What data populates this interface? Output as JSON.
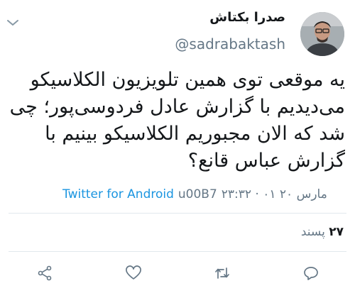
{
  "tweet": {
    "display_name": "صدرا بکتاش",
    "handle": "@sadrabaktash",
    "text": "یه موقعی توی همین تلویزیون الکلاسیکو می‌دیدیم با گزارش عادل فردوسی‌پور؛ چی شد که الان مجبوریم الکلاسیکو بینیم با گزارش عباس قانع؟",
    "timestamp": "۲۳:۳۲ · ۰۱ مارس ۲۰",
    "separator": "u00B7",
    "source": "Twitter for Android",
    "likes_count": "۲۷",
    "likes_label": "پسند"
  },
  "icons": {
    "menu": "chevron-down-icon",
    "share": "share-icon",
    "like": "heart-icon",
    "retweet": "retweet-icon",
    "reply": "reply-icon"
  },
  "colors": {
    "link": "#1b95e0",
    "muted": "#657786",
    "text": "#14171a",
    "divider": "#e1e8ed"
  }
}
